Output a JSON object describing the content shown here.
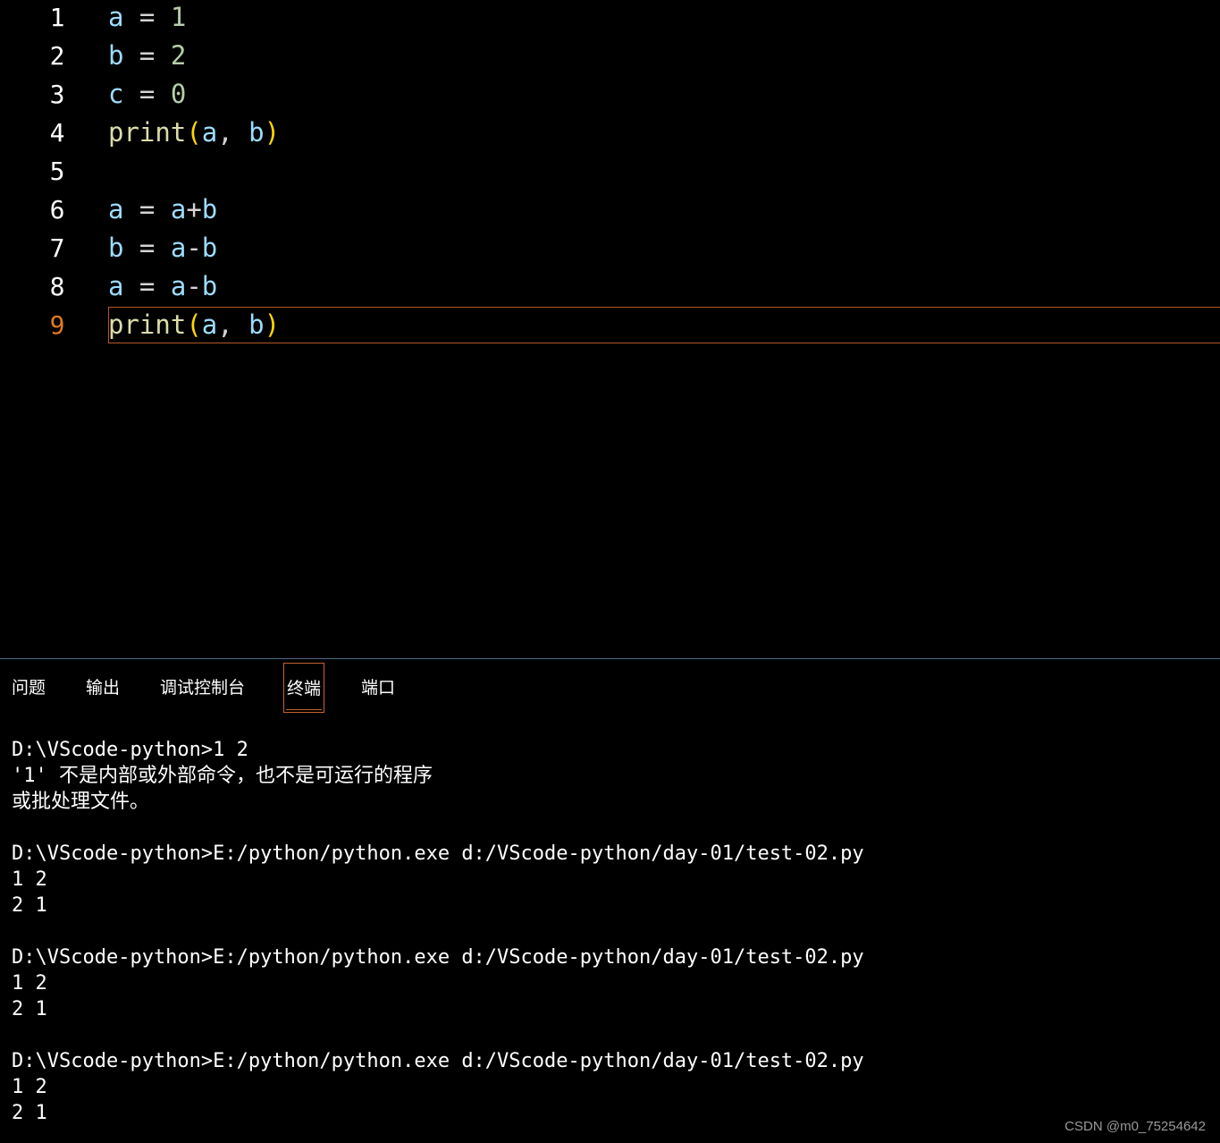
{
  "editor": {
    "lines": [
      {
        "number": "1",
        "tokens": [
          {
            "t": "a",
            "c": "var"
          },
          {
            "t": " = ",
            "c": "op"
          },
          {
            "t": "1",
            "c": "num"
          }
        ]
      },
      {
        "number": "2",
        "tokens": [
          {
            "t": "b",
            "c": "var"
          },
          {
            "t": " = ",
            "c": "op"
          },
          {
            "t": "2",
            "c": "num"
          }
        ]
      },
      {
        "number": "3",
        "tokens": [
          {
            "t": "c",
            "c": "var"
          },
          {
            "t": " = ",
            "c": "op"
          },
          {
            "t": "0",
            "c": "num"
          }
        ]
      },
      {
        "number": "4",
        "tokens": [
          {
            "t": "print",
            "c": "fn"
          },
          {
            "t": "(",
            "c": "par"
          },
          {
            "t": "a",
            "c": "var"
          },
          {
            "t": ", ",
            "c": "op"
          },
          {
            "t": "b",
            "c": "var"
          },
          {
            "t": ")",
            "c": "par"
          }
        ]
      },
      {
        "number": "5",
        "tokens": []
      },
      {
        "number": "6",
        "tokens": [
          {
            "t": "a",
            "c": "var"
          },
          {
            "t": " = ",
            "c": "op"
          },
          {
            "t": "a",
            "c": "var"
          },
          {
            "t": "+",
            "c": "op"
          },
          {
            "t": "b",
            "c": "var"
          }
        ]
      },
      {
        "number": "7",
        "tokens": [
          {
            "t": "b",
            "c": "var"
          },
          {
            "t": " = ",
            "c": "op"
          },
          {
            "t": "a",
            "c": "var"
          },
          {
            "t": "-",
            "c": "op"
          },
          {
            "t": "b",
            "c": "var"
          }
        ]
      },
      {
        "number": "8",
        "tokens": [
          {
            "t": "a",
            "c": "var"
          },
          {
            "t": " = ",
            "c": "op"
          },
          {
            "t": "a",
            "c": "var"
          },
          {
            "t": "-",
            "c": "op"
          },
          {
            "t": "b",
            "c": "var"
          }
        ]
      },
      {
        "number": "9",
        "tokens": [
          {
            "t": "print",
            "c": "fn"
          },
          {
            "t": "(",
            "c": "par"
          },
          {
            "t": "a",
            "c": "var"
          },
          {
            "t": ", ",
            "c": "op"
          },
          {
            "t": "b",
            "c": "var"
          },
          {
            "t": ")",
            "c": "par"
          }
        ],
        "active": true
      }
    ],
    "colors": {
      "var": "#9cdcfe",
      "num": "#b5cea8",
      "fn": "#dcdcaa",
      "par": "#ffd700",
      "active_line_number": "#e07b1d"
    }
  },
  "panel": {
    "tabs": [
      {
        "label": "问题",
        "active": false
      },
      {
        "label": "输出",
        "active": false
      },
      {
        "label": "调试控制台",
        "active": false
      },
      {
        "label": "终端",
        "active": true
      },
      {
        "label": "端口",
        "active": false
      }
    ],
    "terminal_lines": [
      "D:\\VScode-python>1 2",
      "'1' 不是内部或外部命令，也不是可运行的程序",
      "或批处理文件。",
      "",
      "D:\\VScode-python>E:/python/python.exe d:/VScode-python/day-01/test-02.py",
      "1 2",
      "2 1",
      "",
      "D:\\VScode-python>E:/python/python.exe d:/VScode-python/day-01/test-02.py",
      "1 2",
      "2 1",
      "",
      "D:\\VScode-python>E:/python/python.exe d:/VScode-python/day-01/test-02.py",
      "1 2",
      "2 1"
    ]
  },
  "watermark": "CSDN @m0_75254642"
}
